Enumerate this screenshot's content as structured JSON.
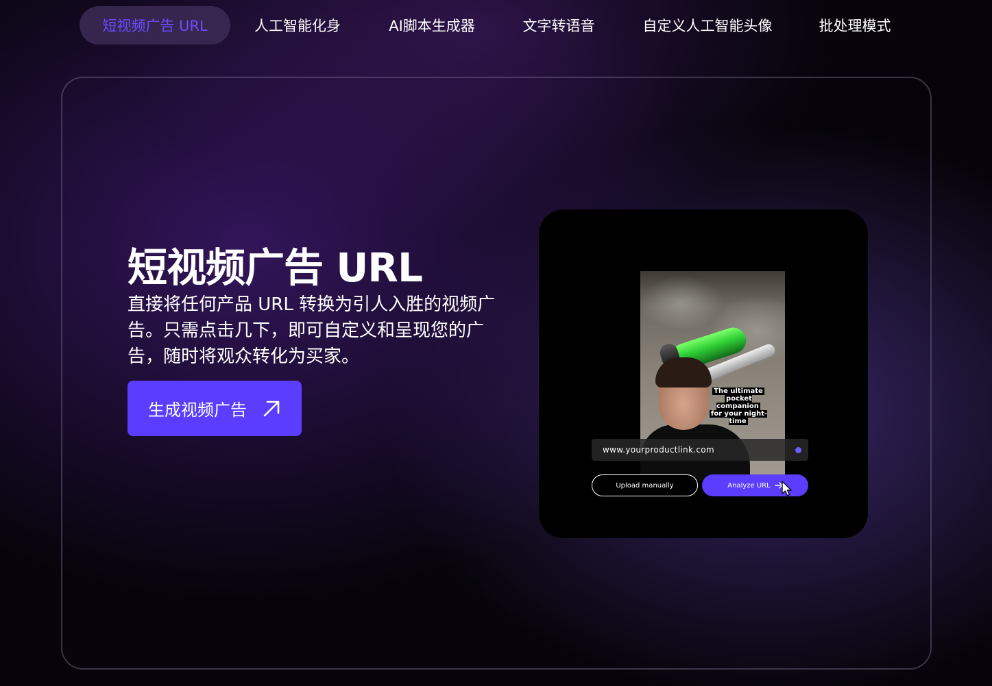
{
  "nav": {
    "tabs": [
      {
        "label": "短视频广告 URL",
        "active": true
      },
      {
        "label": "人工智能化身"
      },
      {
        "label": "AI脚本生成器"
      },
      {
        "label": "文字转语音"
      },
      {
        "label": "自定义人工智能头像"
      },
      {
        "label": "批处理模式"
      }
    ]
  },
  "hero": {
    "title": "短视频广告 URL",
    "description": "直接将任何产品 URL 转换为引人入胜的视频广告。只需点击几下，即可自定义和呈现您的广告，随时将观众转化为买家。",
    "cta_label": "生成视频广告",
    "cta_icon": "arrow-up-right-icon"
  },
  "preview": {
    "caption_lines": [
      "The ultimate",
      "pocket companion",
      "for your night-time"
    ],
    "url_value": "www.yourproductlink.com",
    "upload_label": "Upload manually",
    "analyze_label": "Analyze URL",
    "analyze_icon": "arrow-right-icon"
  },
  "colors": {
    "accent": "#5b3dff",
    "active_tab_text": "#6a4cff",
    "background": "#06040a"
  }
}
